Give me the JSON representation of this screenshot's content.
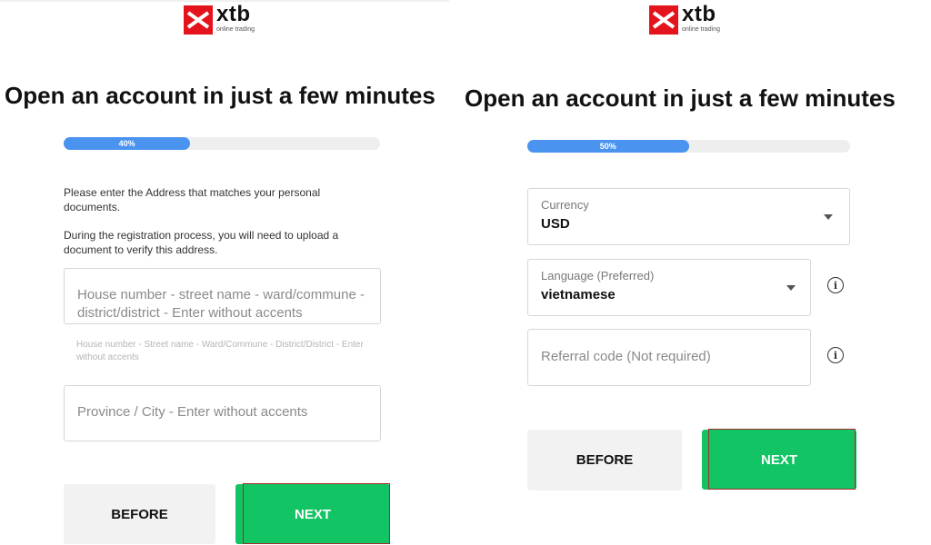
{
  "brand": {
    "name": "xtb",
    "tagline": "online trading",
    "color": "#e3141b"
  },
  "headline": "Open an account in just a few minutes",
  "left_step": {
    "progress_label": "40%",
    "progress_value": 0.4,
    "instruction_1": "Please enter the Address that matches your personal documents.",
    "instruction_2": "During the registration process, you will need to upload a document to verify this address.",
    "address_placeholder": "House number - street name - ward/commune - district/district - Enter without accents",
    "address_hint": "House number - Street name - Ward/Commune - District/District - Enter without accents",
    "province_placeholder": "Province / City - Enter without accents",
    "before_label": "BEFORE",
    "next_label": "NEXT"
  },
  "right_step": {
    "progress_label": "50%",
    "progress_value": 0.5,
    "currency_label": "Currency",
    "currency_value": "USD",
    "language_label": "Language (Preferred)",
    "language_value": "vietnamese",
    "referral_placeholder": "Referral code (Not required)",
    "before_label": "BEFORE",
    "next_label": "NEXT"
  },
  "colors": {
    "accent_blue": "#4a94f0",
    "next_green": "#12c464",
    "highlight_red": "#a52a2a"
  }
}
